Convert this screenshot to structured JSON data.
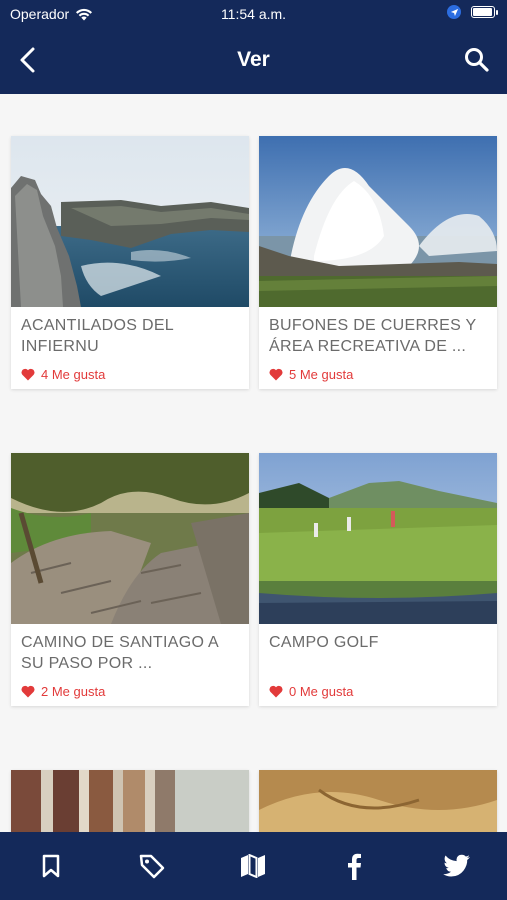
{
  "status_bar": {
    "carrier": "Operador",
    "time": "11:54 a.m."
  },
  "header": {
    "title": "Ver",
    "back_icon": "chevron-left-icon",
    "search_icon": "search-icon",
    "background": "#14295a"
  },
  "cards": [
    {
      "title": "ACANTILADOS DEL INFIERNU",
      "likes": "4 Me gusta"
    },
    {
      "title": "BUFONES DE CUERRES Y ÁREA RECREATIVA DE ...",
      "likes": "5 Me gusta"
    },
    {
      "title": "CAMINO DE SANTIAGO A SU PASO POR ...",
      "likes": "2 Me gusta"
    },
    {
      "title": "CAMPO GOLF",
      "likes": "0 Me gusta"
    },
    {
      "title": "",
      "likes": ""
    },
    {
      "title": "",
      "likes": ""
    }
  ],
  "tab_bar": {
    "items": [
      "bookmark-icon",
      "tag-icon",
      "map-icon",
      "facebook-icon",
      "twitter-icon"
    ]
  },
  "colors": {
    "accent": "#14295a",
    "like": "#e23a3a",
    "text": "#6b6b6b"
  }
}
